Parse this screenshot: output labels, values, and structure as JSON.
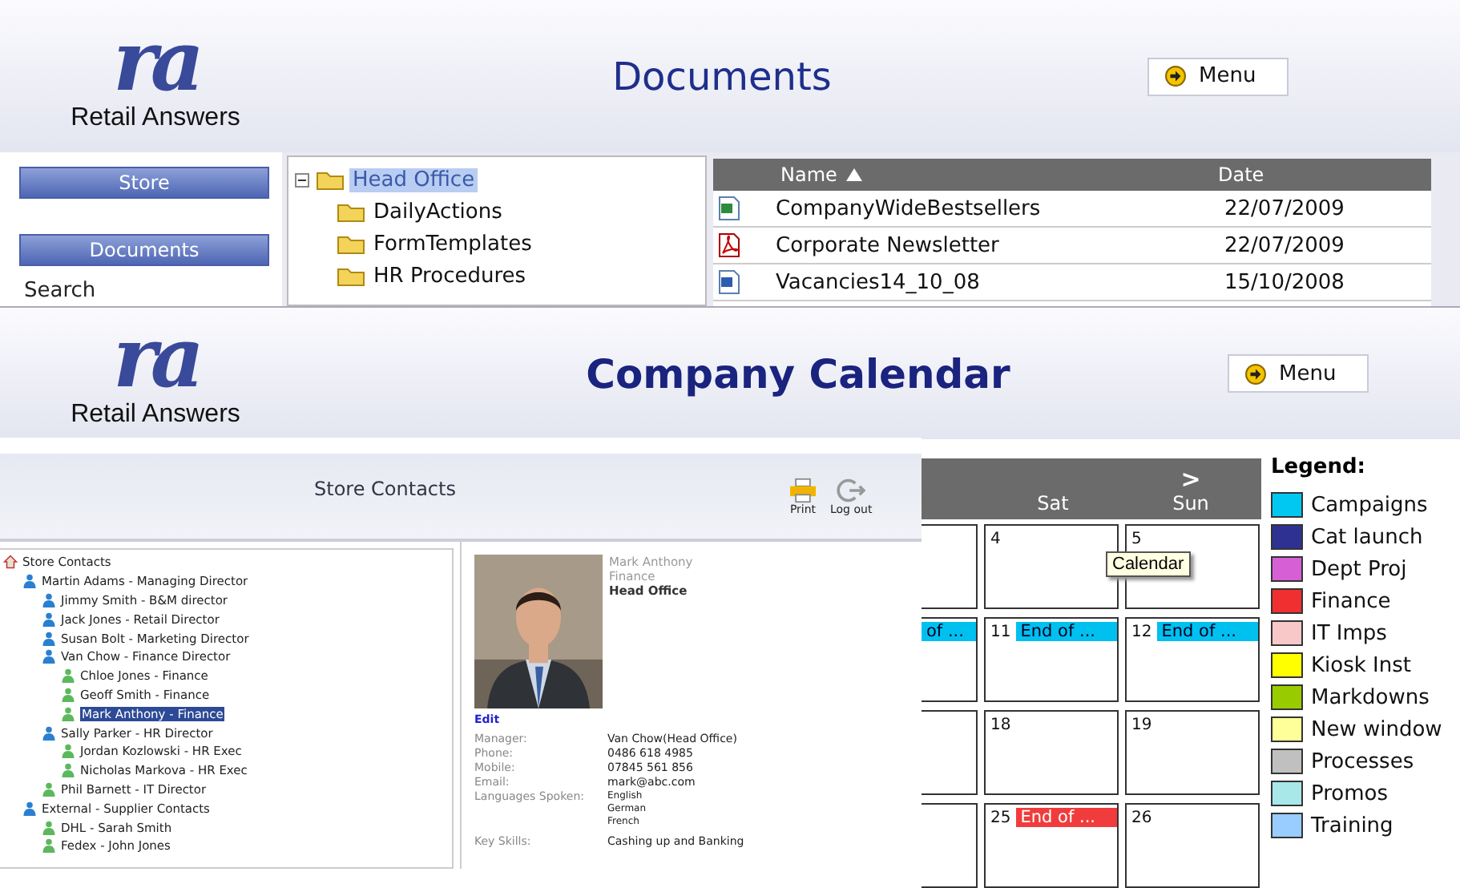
{
  "documents_window": {
    "logo": {
      "mark": "ra",
      "name": "Retail Answers"
    },
    "title": "Documents",
    "menu_button": "Menu",
    "sidebar": [
      {
        "label": "Store",
        "kind": "button"
      },
      {
        "label": "Documents",
        "kind": "button"
      },
      {
        "label": "Search",
        "kind": "link"
      }
    ],
    "folder_tree": [
      {
        "label": "Head Office",
        "selected": true,
        "expanded": true,
        "children": [
          {
            "label": "DailyActions",
            "selected": false
          },
          {
            "label": "FormTemplates",
            "selected": false
          },
          {
            "label": "HR Procedures",
            "selected": false
          }
        ]
      }
    ],
    "files": {
      "columns": [
        {
          "label": "Name",
          "sorted_ascending": true
        },
        {
          "label": "Date"
        }
      ],
      "rows": [
        {
          "kind": "excel",
          "name": "CompanyWideBestsellers",
          "date": "22/07/2009"
        },
        {
          "kind": "pdf",
          "name": "Corporate Newsletter",
          "date": "22/07/2009"
        },
        {
          "kind": "word",
          "name": "Vacancies14_10_08",
          "date": "15/10/2008"
        }
      ]
    }
  },
  "calendar_window": {
    "logo": {
      "mark": "ra",
      "name": "Retail Answers"
    },
    "title": "Company Calendar",
    "menu_button": "Menu",
    "calendar": {
      "next_button": ">",
      "days": [
        "Sat",
        "Sun"
      ],
      "weeks": [
        [
          {
            "kind": "partial"
          },
          {
            "kind": "day",
            "date": "4"
          },
          {
            "kind": "day",
            "date": "5"
          }
        ],
        [
          {
            "kind": "partial",
            "events": [
              {
                "text": "of ...",
                "color": "#00c0f0"
              }
            ]
          },
          {
            "kind": "day",
            "date": "11",
            "events": [
              {
                "text": "End of ...",
                "color": "#00c0f0"
              }
            ]
          },
          {
            "kind": "day",
            "date": "12",
            "events": [
              {
                "text": "End of ...",
                "color": "#00c0f0"
              }
            ]
          }
        ],
        [
          {
            "kind": "partial"
          },
          {
            "kind": "day",
            "date": "18"
          },
          {
            "kind": "day",
            "date": "19"
          }
        ],
        [
          {
            "kind": "partial"
          },
          {
            "kind": "day",
            "date": "25",
            "events": [
              {
                "text": "End of ...",
                "color": "#f03c3c"
              }
            ]
          },
          {
            "kind": "day",
            "date": "26"
          }
        ]
      ]
    },
    "tooltip": "Calendar",
    "legend": {
      "title": "Legend:",
      "items": [
        {
          "label": "Campaigns",
          "color": "#00c8f0"
        },
        {
          "label": "Cat launch",
          "color": "#2e3192"
        },
        {
          "label": "Dept Proj",
          "color": "#d65fd6"
        },
        {
          "label": "Finance",
          "color": "#f03030"
        },
        {
          "label": "IT Imps",
          "color": "#f8c8c8"
        },
        {
          "label": "Kiosk Inst",
          "color": "#ffff00"
        },
        {
          "label": "Markdowns",
          "color": "#99cc00"
        },
        {
          "label": "New window",
          "color": "#ffff99"
        },
        {
          "label": "Processes",
          "color": "#c0c0c0"
        },
        {
          "label": "Promos",
          "color": "#a8e8e8"
        },
        {
          "label": "Training",
          "color": "#99ccff"
        }
      ]
    }
  },
  "contacts_window": {
    "title": "Store Contacts",
    "actions": [
      {
        "label": "Print",
        "kind": "print"
      },
      {
        "label": "Log out",
        "kind": "logout"
      }
    ],
    "tree": [
      {
        "label": "Store Contacts",
        "kind": "root",
        "selected": false,
        "children": [
          {
            "label": "Martin Adams - Managing Director",
            "kind": "group",
            "selected": false,
            "children": [
              {
                "label": "Jimmy Smith - B&M director",
                "kind": "group",
                "selected": false
              },
              {
                "label": "Jack Jones - Retail Director",
                "kind": "group",
                "selected": false
              },
              {
                "label": "Susan Bolt - Marketing Director",
                "kind": "group",
                "selected": false
              },
              {
                "label": "Van Chow - Finance Director",
                "kind": "group",
                "selected": false,
                "children": [
                  {
                    "label": "Chloe Jones - Finance",
                    "kind": "person",
                    "selected": false
                  },
                  {
                    "label": "Geoff Smith - Finance",
                    "kind": "person",
                    "selected": false
                  },
                  {
                    "label": "Mark Anthony - Finance",
                    "kind": "person",
                    "selected": true
                  }
                ]
              },
              {
                "label": "Sally Parker - HR Director",
                "kind": "group",
                "selected": false,
                "children": [
                  {
                    "label": "Jordan Kozlowski - HR Exec",
                    "kind": "person",
                    "selected": false
                  },
                  {
                    "label": "Nicholas Markova - HR Exec",
                    "kind": "person",
                    "selected": false
                  }
                ]
              },
              {
                "label": "Phil Barnett - IT Director",
                "kind": "person",
                "selected": false
              }
            ]
          },
          {
            "label": "External - Supplier Contacts",
            "kind": "group",
            "selected": false,
            "children": [
              {
                "label": "DHL - Sarah Smith",
                "kind": "person",
                "selected": false
              },
              {
                "label": "Fedex - John Jones",
                "kind": "person",
                "selected": false
              }
            ]
          }
        ]
      }
    ],
    "detail": {
      "name": "Mark Anthony",
      "department": "Finance",
      "location": "Head Office",
      "edit_link": "Edit",
      "fields": [
        {
          "label": "Manager:",
          "values": [
            "Van Chow(Head Office)"
          ]
        },
        {
          "label": "Phone:",
          "values": [
            "0486 618 4985"
          ]
        },
        {
          "label": "Mobile:",
          "values": [
            "07845 561 856"
          ]
        },
        {
          "label": "Email:",
          "values": [
            "mark@abc.com"
          ]
        },
        {
          "label": "Languages Spoken:",
          "values": [
            "English",
            "German",
            "French"
          ]
        },
        {
          "label": "Key Skills:",
          "values": [
            "Cashing up and Banking"
          ]
        }
      ]
    }
  }
}
